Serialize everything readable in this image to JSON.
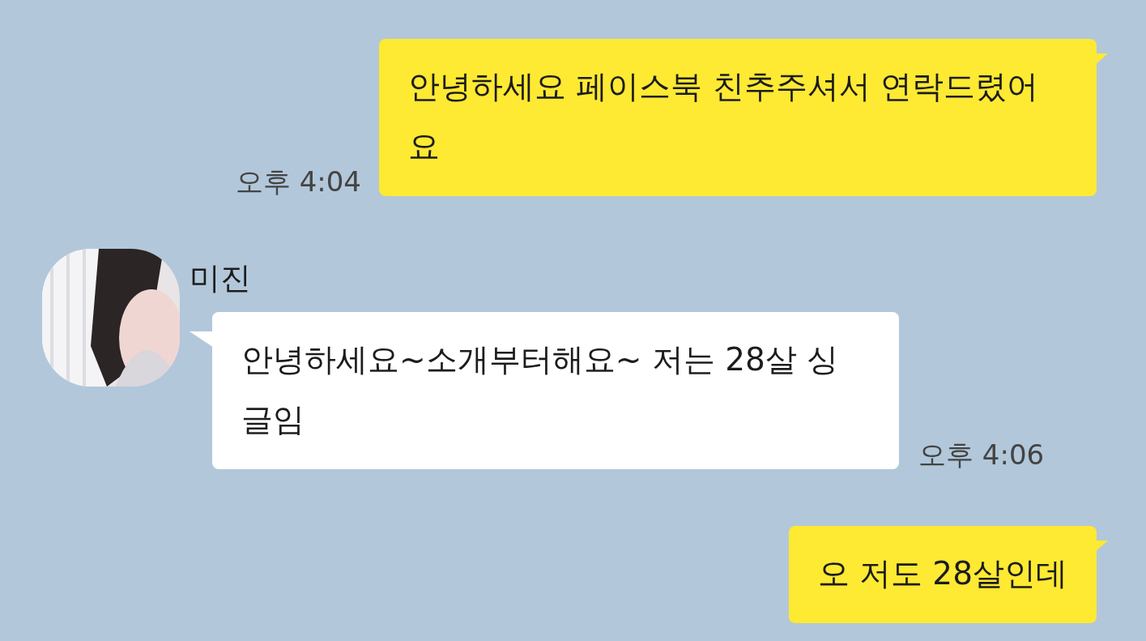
{
  "messages": [
    {
      "kind": "sent",
      "text": "안녕하세요 페이스북 친추주셔서 연락드렸어요",
      "time": "오후 4:04"
    },
    {
      "kind": "received",
      "sender": "미진",
      "text": "안녕하세요~소개부터해요~ 저는 28살 싱글임",
      "time": "오후 4:06"
    },
    {
      "kind": "sent",
      "text": "오 저도 28살인데"
    }
  ]
}
